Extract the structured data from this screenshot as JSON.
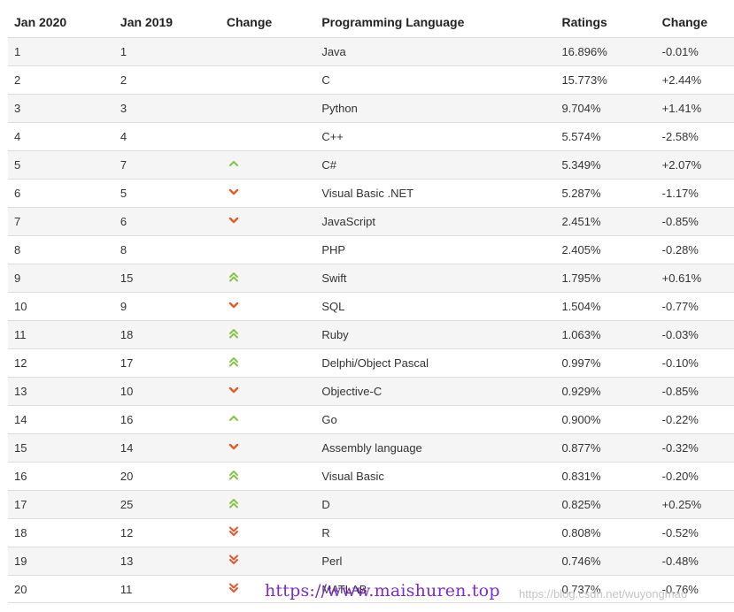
{
  "table": {
    "headers": [
      "Jan 2020",
      "Jan 2019",
      "Change",
      "Programming Language",
      "Ratings",
      "Change"
    ],
    "rows": [
      {
        "jan2020": "1",
        "jan2019": "1",
        "change_icon": "none",
        "language": "Java",
        "ratings": "16.896%",
        "change": "-0.01%"
      },
      {
        "jan2020": "2",
        "jan2019": "2",
        "change_icon": "none",
        "language": "C",
        "ratings": "15.773%",
        "change": "+2.44%"
      },
      {
        "jan2020": "3",
        "jan2019": "3",
        "change_icon": "none",
        "language": "Python",
        "ratings": "9.704%",
        "change": "+1.41%"
      },
      {
        "jan2020": "4",
        "jan2019": "4",
        "change_icon": "none",
        "language": "C++",
        "ratings": "5.574%",
        "change": "-2.58%"
      },
      {
        "jan2020": "5",
        "jan2019": "7",
        "change_icon": "up",
        "language": "C#",
        "ratings": "5.349%",
        "change": "+2.07%"
      },
      {
        "jan2020": "6",
        "jan2019": "5",
        "change_icon": "down",
        "language": "Visual Basic .NET",
        "ratings": "5.287%",
        "change": "-1.17%"
      },
      {
        "jan2020": "7",
        "jan2019": "6",
        "change_icon": "down",
        "language": "JavaScript",
        "ratings": "2.451%",
        "change": "-0.85%"
      },
      {
        "jan2020": "8",
        "jan2019": "8",
        "change_icon": "none",
        "language": "PHP",
        "ratings": "2.405%",
        "change": "-0.28%"
      },
      {
        "jan2020": "9",
        "jan2019": "15",
        "change_icon": "double-up",
        "language": "Swift",
        "ratings": "1.795%",
        "change": "+0.61%"
      },
      {
        "jan2020": "10",
        "jan2019": "9",
        "change_icon": "down",
        "language": "SQL",
        "ratings": "1.504%",
        "change": "-0.77%"
      },
      {
        "jan2020": "11",
        "jan2019": "18",
        "change_icon": "double-up",
        "language": "Ruby",
        "ratings": "1.063%",
        "change": "-0.03%"
      },
      {
        "jan2020": "12",
        "jan2019": "17",
        "change_icon": "double-up",
        "language": "Delphi/Object Pascal",
        "ratings": "0.997%",
        "change": "-0.10%"
      },
      {
        "jan2020": "13",
        "jan2019": "10",
        "change_icon": "down",
        "language": "Objective-C",
        "ratings": "0.929%",
        "change": "-0.85%"
      },
      {
        "jan2020": "14",
        "jan2019": "16",
        "change_icon": "up",
        "language": "Go",
        "ratings": "0.900%",
        "change": "-0.22%"
      },
      {
        "jan2020": "15",
        "jan2019": "14",
        "change_icon": "down",
        "language": "Assembly language",
        "ratings": "0.877%",
        "change": "-0.32%"
      },
      {
        "jan2020": "16",
        "jan2019": "20",
        "change_icon": "double-up",
        "language": "Visual Basic",
        "ratings": "0.831%",
        "change": "-0.20%"
      },
      {
        "jan2020": "17",
        "jan2019": "25",
        "change_icon": "double-up",
        "language": "D",
        "ratings": "0.825%",
        "change": "+0.25%"
      },
      {
        "jan2020": "18",
        "jan2019": "12",
        "change_icon": "double-down",
        "language": "R",
        "ratings": "0.808%",
        "change": "-0.52%"
      },
      {
        "jan2020": "19",
        "jan2019": "13",
        "change_icon": "double-down",
        "language": "Perl",
        "ratings": "0.746%",
        "change": "-0.48%"
      },
      {
        "jan2020": "20",
        "jan2019": "11",
        "change_icon": "double-down",
        "language": "MATLAB",
        "ratings": "0.737%",
        "change": "-0.76%"
      }
    ]
  },
  "icons": {
    "up": "chevron-up-icon",
    "double-up": "double-chevron-up-icon",
    "down": "chevron-down-icon",
    "double-down": "double-chevron-down-icon"
  },
  "colors": {
    "up": "#8bc34a",
    "down": "#e8562a",
    "row_alt": "#f5f5f5",
    "border": "#dddddd"
  },
  "watermarks": {
    "main": "https://www.maishuren.top",
    "csdn": "https://blog.csdn.net/wuyongmao"
  }
}
